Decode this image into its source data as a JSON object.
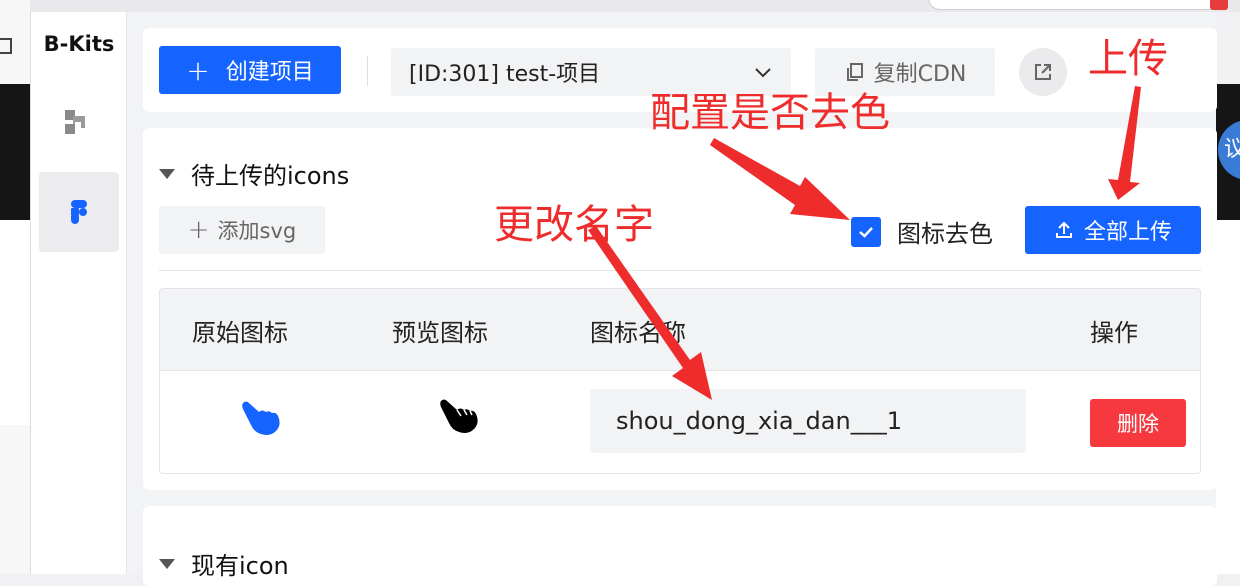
{
  "brand": "B-Kits",
  "toolbar": {
    "create_label": "创建项目",
    "project_select_value": "[ID:301] test-项目",
    "copy_cdn_label": "复制CDN"
  },
  "pending_section": {
    "title": "待上传的icons",
    "add_svg_label": "添加svg",
    "decolor_label": "图标去色",
    "decolor_checked": true,
    "upload_all_label": "全部上传",
    "table": {
      "headers": [
        "原始图标",
        "预览图标",
        "图标名称",
        "操作"
      ],
      "rows": [
        {
          "original_icon": "hand-pointer-blue-icon",
          "preview_icon": "hand-pointer-black-icon",
          "name": "shou_dong_xia_dan___1",
          "action_label": "删除"
        }
      ]
    }
  },
  "existing_section": {
    "title": "现有icon"
  },
  "annotations": {
    "upload": "上传",
    "decolor_config": "配置是否去色",
    "rename": "更改名字"
  },
  "colors": {
    "primary": "#1664ff",
    "danger": "#f5393f",
    "annotation": "#ee2c2c",
    "original_icon": "#1664ff",
    "preview_icon": "#000000"
  }
}
